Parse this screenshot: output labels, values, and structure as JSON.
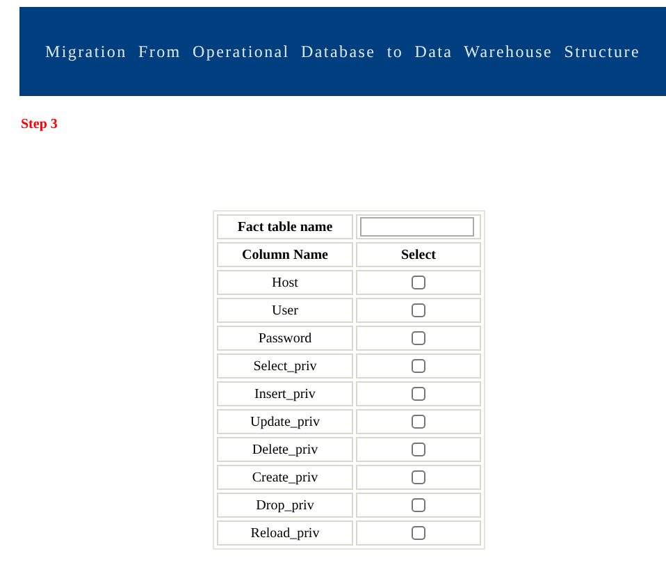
{
  "header": {
    "title": "Migration From Operational Database to Data Warehouse Structure"
  },
  "step": {
    "label": "Step 3"
  },
  "fact_table": {
    "label": "Fact table name"
  },
  "table": {
    "columns": [
      "Column Name",
      "Select"
    ],
    "rows": [
      {
        "name": "Host",
        "checked": false
      },
      {
        "name": "User",
        "checked": false
      },
      {
        "name": "Password",
        "checked": false
      },
      {
        "name": "Select_priv",
        "checked": false
      },
      {
        "name": "Insert_priv",
        "checked": false
      },
      {
        "name": "Update_priv",
        "checked": false
      },
      {
        "name": "Delete_priv",
        "checked": false
      },
      {
        "name": "Create_priv",
        "checked": false
      },
      {
        "name": "Drop_priv",
        "checked": false
      },
      {
        "name": "Reload_priv",
        "checked": false
      }
    ]
  }
}
